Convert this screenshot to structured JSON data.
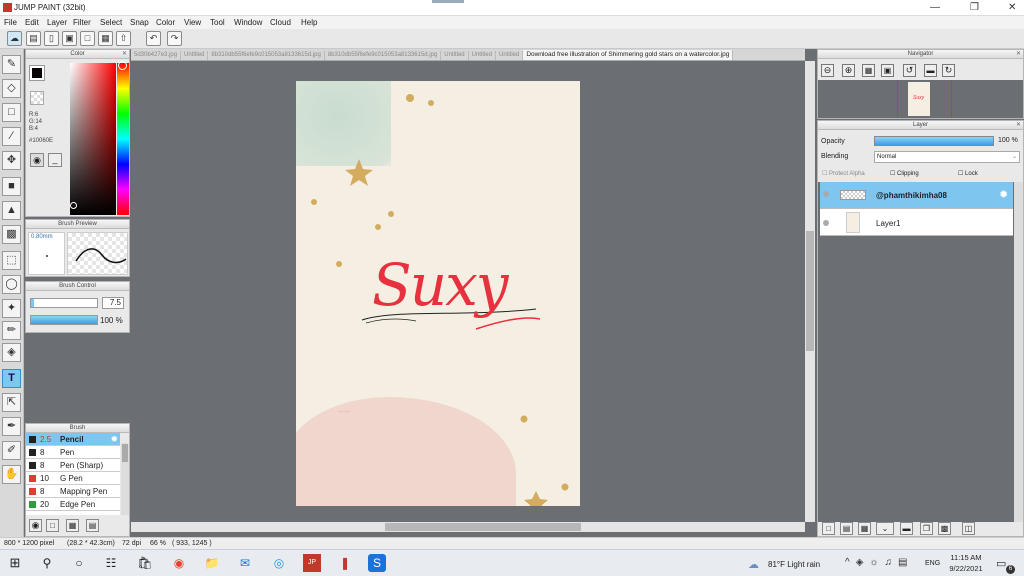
{
  "window": {
    "title": "JUMP PAINT (32bit)"
  },
  "menu": [
    "File",
    "Edit",
    "Layer",
    "Filter",
    "Select",
    "Snap",
    "Color",
    "View",
    "Tool",
    "Window",
    "Cloud",
    "Help"
  ],
  "color": {
    "panel_title": "Color",
    "r": "R:6",
    "g": "G:14",
    "b": "B:4",
    "hex": "#10060E",
    "current": "#0a0606"
  },
  "brush_preview": {
    "title": "Brush Preview",
    "size": "0.80mm"
  },
  "brush_control": {
    "title": "Brush Control",
    "size": "7.5",
    "opacity": "100 %",
    "opacity_fraction": 1.0
  },
  "brush": {
    "title": "Brush",
    "items": [
      {
        "size": "2.5",
        "name": "Pencil",
        "color": "#222222"
      },
      {
        "size": "8",
        "name": "Pen",
        "color": "#222222"
      },
      {
        "size": "8",
        "name": "Pen (Sharp)",
        "color": "#222222"
      },
      {
        "size": "10",
        "name": "G Pen",
        "color": "#e53935"
      },
      {
        "size": "8",
        "name": "Mapping Pen",
        "color": "#e53935"
      },
      {
        "size": "20",
        "name": "Edge Pen",
        "color": "#2e9e3a"
      }
    ]
  },
  "tabs": [
    "5d30b427e3.jpg",
    "Untitled",
    "8b310db55f6efe9c015053a8133615d.jpg",
    "8b310db55f6efe9c015053a8133615d.jpg",
    "Untitled",
    "Untitled",
    "Untitled",
    "Download free illustration of Shimmering gold stars on a watercolor.jpg"
  ],
  "canvas": {
    "artwork_text": "Suxy",
    "accent": "#e8313f"
  },
  "navigator": {
    "title": "Navigator"
  },
  "layer": {
    "title": "Layer",
    "opacity_label": "Opacity",
    "opacity_value": "100 %",
    "blending_label": "Blending",
    "blending_value": "Normal",
    "protect_alpha": "Protect Alpha",
    "clipping": "Clipping",
    "lock": "Lock",
    "layers": [
      {
        "name": "@phamthikimha08"
      },
      {
        "name": "Layer1"
      }
    ]
  },
  "status": {
    "size": "800 * 1200 pixel",
    "dims": "(28.2 * 42.3cm)",
    "dpi": "72 dpi",
    "zoom": "66 %",
    "coords": "( 933, 1245 )"
  },
  "taskbar": {
    "weather": "81°F  Light rain",
    "lang": "ENG",
    "time": "11:15 AM",
    "date": "9/22/2021",
    "notif": "6"
  }
}
